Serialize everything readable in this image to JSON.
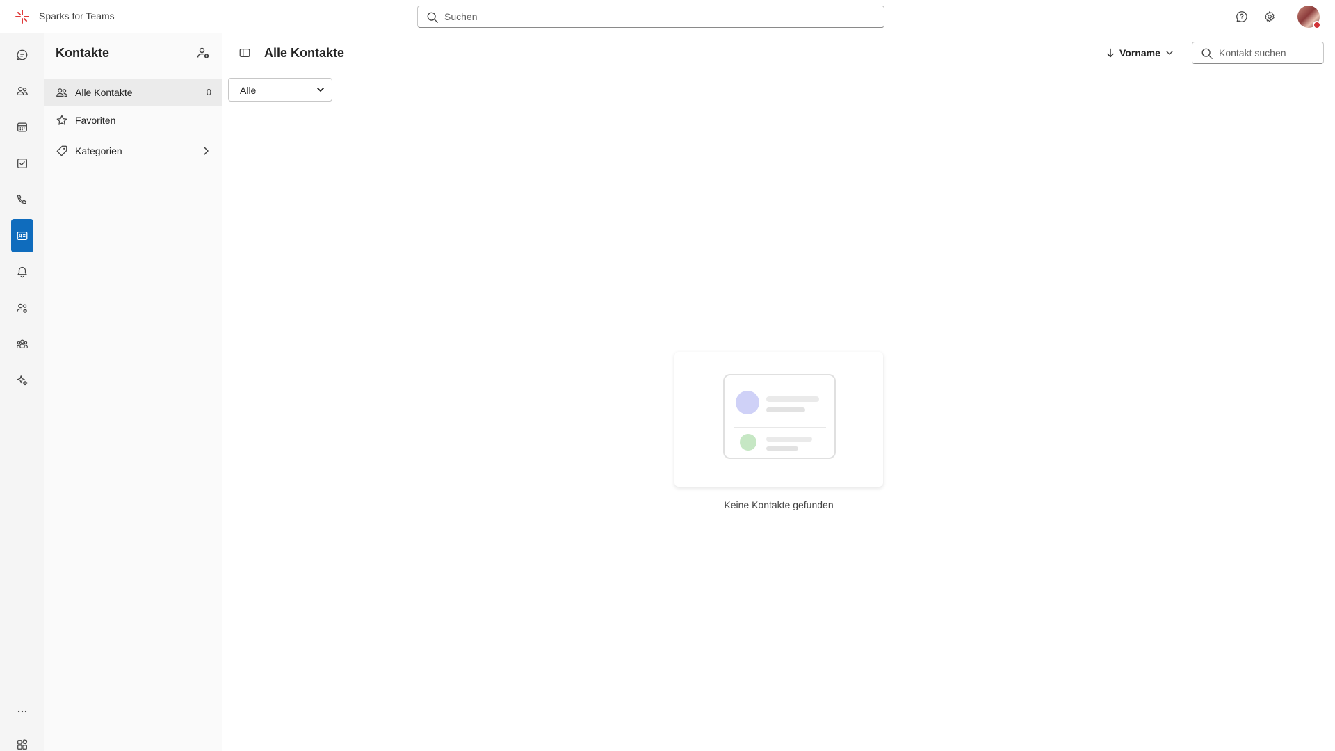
{
  "app": {
    "title": "Sparks for Teams",
    "brand_color": "#e03b3b"
  },
  "topbar": {
    "search_placeholder": "Suchen",
    "help_icon": "help-circle-icon",
    "settings_icon": "gear-icon"
  },
  "rail": {
    "items": [
      {
        "name": "chat-icon"
      },
      {
        "name": "people-icon"
      },
      {
        "name": "calendar-icon"
      },
      {
        "name": "tasks-icon"
      },
      {
        "name": "phone-icon"
      },
      {
        "name": "contact-card-icon",
        "active": true
      },
      {
        "name": "bell-icon"
      },
      {
        "name": "people-settings-icon"
      },
      {
        "name": "team-icon"
      },
      {
        "name": "sparkle-icon"
      },
      {
        "name": "more-icon"
      },
      {
        "name": "apps-icon"
      }
    ],
    "active_color": "#0f6cbd"
  },
  "sidebar": {
    "title": "Kontakte",
    "items": [
      {
        "label": "Alle Kontakte",
        "count": "0",
        "icon": "people-icon"
      },
      {
        "label": "Favoriten",
        "icon": "star-icon"
      },
      {
        "label": "Kategorien",
        "icon": "tag-icon"
      }
    ]
  },
  "main": {
    "title": "Alle Kontakte",
    "sort_label": "Vorname",
    "search_placeholder": "Kontakt suchen",
    "filter_value": "Alle",
    "empty_text": "Keine Kontakte gefunden"
  }
}
